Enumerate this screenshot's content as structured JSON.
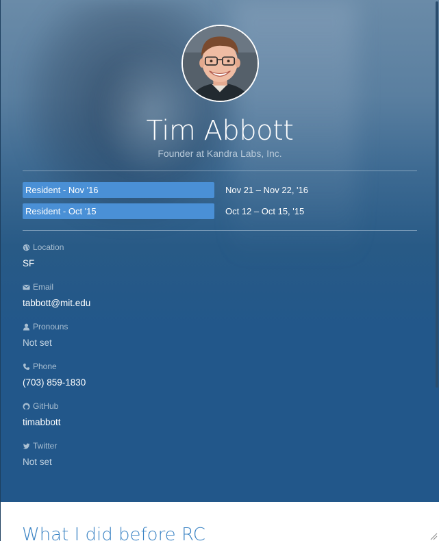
{
  "profile": {
    "name": "Tim Abbott",
    "title": "Founder at Kandra Labs, Inc."
  },
  "batches": [
    {
      "label": "Resident - Nov '16",
      "dates": "Nov 21 – Nov 22, '16"
    },
    {
      "label": "Resident - Oct '15",
      "dates": "Oct 12 – Oct 15, '15"
    }
  ],
  "fields": {
    "location": {
      "label": "Location",
      "value": "SF",
      "icon": "globe-icon"
    },
    "email": {
      "label": "Email",
      "value": "tabbott@mit.edu",
      "icon": "envelope-icon"
    },
    "pronouns": {
      "label": "Pronouns",
      "value": "Not set",
      "icon": "user-icon"
    },
    "phone": {
      "label": "Phone",
      "value": "(703) 859-1830",
      "icon": "phone-icon"
    },
    "github": {
      "label": "GitHub",
      "value": "timabbott",
      "icon": "github-icon"
    },
    "twitter": {
      "label": "Twitter",
      "value": "Not set",
      "icon": "twitter-icon"
    }
  },
  "section": {
    "title": "What I did before RC"
  },
  "colors": {
    "header_bg": "#22578a",
    "batch_tag": "#4a90d6",
    "section_title": "#3a83c4"
  }
}
